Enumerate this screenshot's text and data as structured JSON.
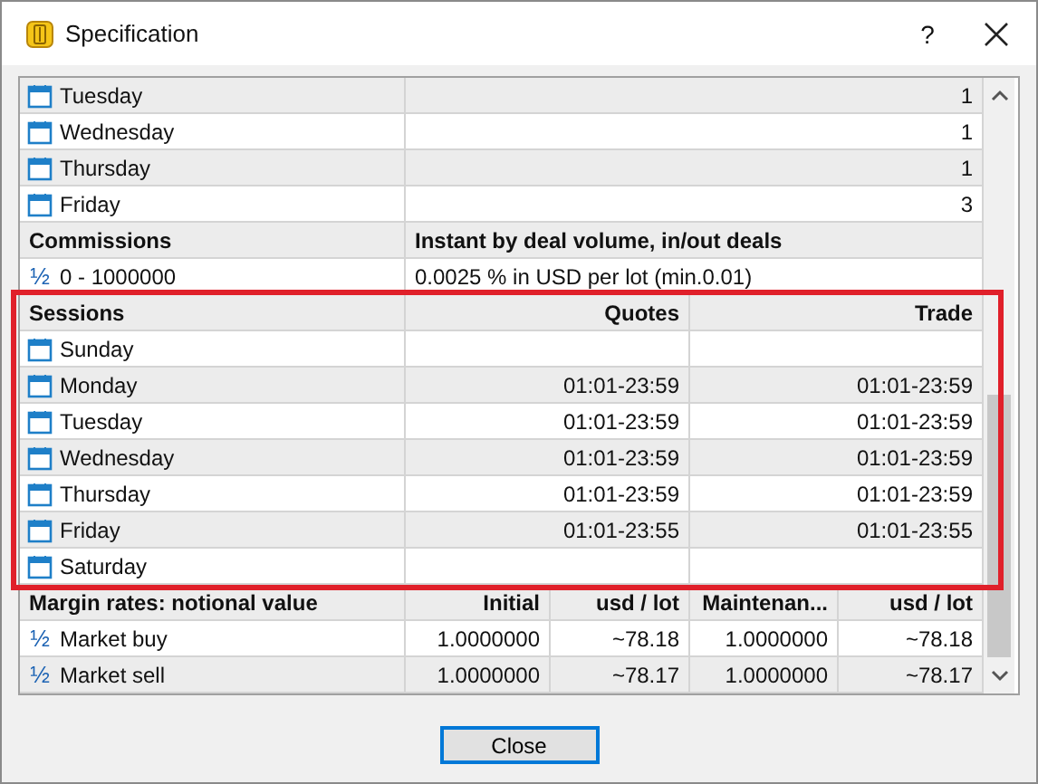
{
  "window": {
    "title": "Specification",
    "help": "?"
  },
  "schedule": {
    "rows": [
      {
        "kind": "day",
        "label": "Tuesday",
        "value": "1"
      },
      {
        "kind": "day",
        "label": "Wednesday",
        "value": "1"
      },
      {
        "kind": "day",
        "label": "Thursday",
        "value": "1"
      },
      {
        "kind": "day",
        "label": "Friday",
        "value": "3"
      }
    ]
  },
  "commissions": {
    "columns": [
      "Commissions",
      "Instant by deal volume, in/out deals"
    ],
    "rows": [
      {
        "kind": "rate",
        "symbol": "½",
        "label": "0 - 1000000",
        "value": "0.0025 % in USD per lot (min.0.01)"
      }
    ]
  },
  "sessions": {
    "highlighted": true,
    "columns": [
      "Sessions",
      "Quotes",
      "Trade"
    ],
    "rows": [
      {
        "kind": "day",
        "label": "Sunday",
        "quotes": "",
        "trade": ""
      },
      {
        "kind": "day",
        "label": "Monday",
        "quotes": "01:01-23:59",
        "trade": "01:01-23:59"
      },
      {
        "kind": "day",
        "label": "Tuesday",
        "quotes": "01:01-23:59",
        "trade": "01:01-23:59"
      },
      {
        "kind": "day",
        "label": "Wednesday",
        "quotes": "01:01-23:59",
        "trade": "01:01-23:59"
      },
      {
        "kind": "day",
        "label": "Thursday",
        "quotes": "01:01-23:59",
        "trade": "01:01-23:59"
      },
      {
        "kind": "day",
        "label": "Friday",
        "quotes": "01:01-23:55",
        "trade": "01:01-23:55"
      },
      {
        "kind": "day",
        "label": "Saturday",
        "quotes": "",
        "trade": ""
      }
    ]
  },
  "margin_rates": {
    "columns": [
      "Margin rates: notional value",
      "Initial",
      "usd / lot",
      "Maintenan...",
      "usd / lot"
    ],
    "rows": [
      {
        "kind": "rate",
        "symbol": "½",
        "cells": [
          "Market buy",
          "1.0000000",
          "~78.18",
          "1.0000000",
          "~78.18"
        ]
      },
      {
        "kind": "rate",
        "symbol": "½",
        "cells": [
          "Market sell",
          "1.0000000",
          "~78.17",
          "1.0000000",
          "~78.17"
        ]
      }
    ]
  },
  "buttons": [
    "Close"
  ]
}
